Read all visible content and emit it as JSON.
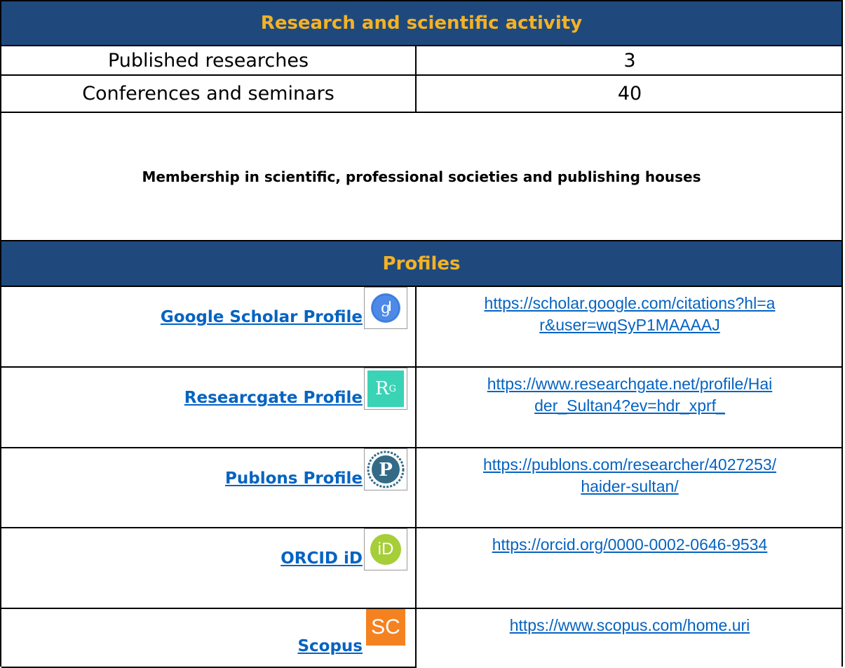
{
  "research": {
    "title": "Research and scientific activity",
    "stats": [
      {
        "label": "Published researches",
        "value": "3"
      },
      {
        "label": "Conferences and seminars",
        "value": "40"
      }
    ],
    "membership_label": "Membership in scientific, professional societies and publishing houses"
  },
  "profiles": {
    "title": "Profiles",
    "items": [
      {
        "label": "Google Scholar Profile",
        "icon": "google-scholar-icon",
        "url_line1": "https://scholar.google.com/citations?hl=a",
        "url_line2": "r&user=wqSyP1MAAAAJ"
      },
      {
        "label": "Researcgate Profile",
        "icon": "researchgate-icon",
        "url_line1": "https://www.researchgate.net/profile/Hai",
        "url_line2": "der_Sultan4?ev=hdr_xprf_"
      },
      {
        "label": "Publons Profile",
        "icon": "publons-icon",
        "url_line1": "https://publons.com/researcher/4027253/",
        "url_line2": "haider-sultan/"
      },
      {
        "label": "ORCID iD",
        "icon": "orcid-icon",
        "icon_text": "iD",
        "url_line1": "https://orcid.org/0000-0002-0646-9534",
        "url_line2": ""
      },
      {
        "label": "Scopus",
        "icon": "scopus-icon",
        "icon_text": "SC",
        "url_line1": "https://www.scopus.com/home.uri",
        "url_line2": ""
      }
    ]
  },
  "colors": {
    "header_bg": "#1f497d",
    "header_text": "#f4b224",
    "link": "#0563c1"
  }
}
